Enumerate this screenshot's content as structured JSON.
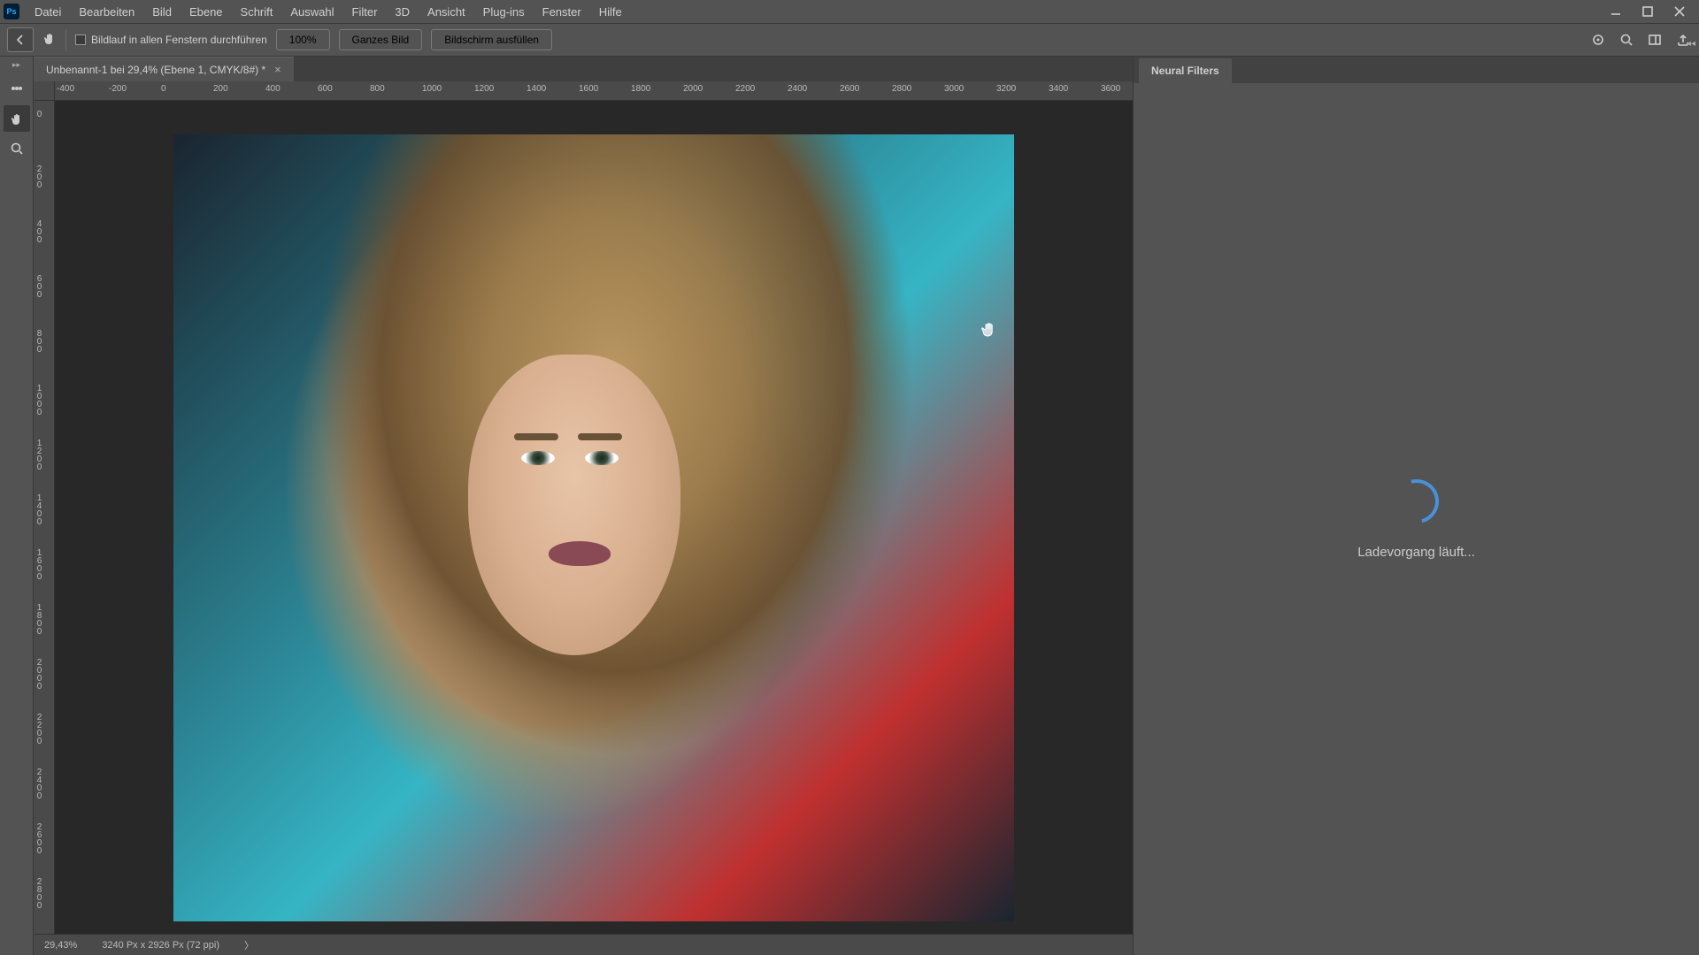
{
  "app": {
    "short": "Ps"
  },
  "menu": {
    "items": [
      "Datei",
      "Bearbeiten",
      "Bild",
      "Ebene",
      "Schrift",
      "Auswahl",
      "Filter",
      "3D",
      "Ansicht",
      "Plug-ins",
      "Fenster",
      "Hilfe"
    ]
  },
  "options_bar": {
    "scroll_all_label": "Bildlauf in allen Fenstern durchführen",
    "zoom_100": "100%",
    "fit_screen": "Ganzes Bild",
    "fill_screen": "Bildschirm ausfüllen"
  },
  "document": {
    "tab_title": "Unbenannt-1 bei 29,4% (Ebene 1, CMYK/8#) *"
  },
  "ruler_h": [
    "-400",
    "-200",
    "0",
    "200",
    "400",
    "600",
    "800",
    "1000",
    "1200",
    "1400",
    "1600",
    "1800",
    "2000",
    "2200",
    "2400",
    "2600",
    "2800",
    "3000",
    "3200",
    "3400",
    "3600"
  ],
  "ruler_v": [
    "0",
    "200",
    "400",
    "600",
    "800",
    "1000",
    "1200",
    "1400",
    "1600",
    "1800",
    "2000",
    "2200",
    "2400",
    "2600",
    "2800"
  ],
  "status": {
    "zoom": "29,43%",
    "dimensions": "3240 Px x 2926 Px (72 ppi)"
  },
  "right_panel": {
    "tab": "Neural Filters",
    "loading_text": "Ladevorgang läuft..."
  }
}
